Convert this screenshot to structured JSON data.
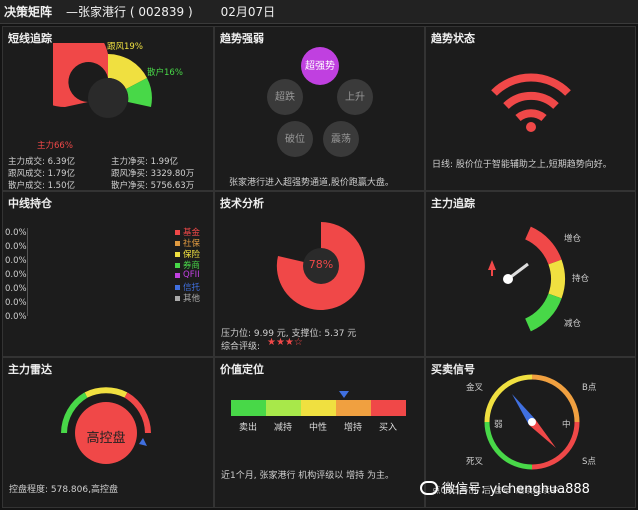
{
  "title": {
    "main": "决策矩阵",
    "stock": "—张家港行 ( 002839 )",
    "date": "02月07日"
  },
  "panels": {
    "short_track": {
      "title": "短线追踪",
      "labels": {
        "gengfeng": "跟风19%",
        "sanhu": "散户16%",
        "zhuli": "主力66%"
      },
      "stats": [
        "主力成交: 6.39亿",
        "主力净买: 1.99亿",
        "跟风成交: 1.79亿",
        "跟风净买: 3329.80万",
        "散户成交: 1.50亿",
        "散户净买: 5756.63万"
      ]
    },
    "trend_strength": {
      "title": "趋势强弱",
      "bubbles": [
        "超强势",
        "超跌",
        "上升",
        "破位",
        "震荡"
      ],
      "note": "张家港行进入超强势通道,股价跑赢大盘。"
    },
    "trend_state": {
      "title": "趋势状态",
      "note": "日线: 股价位于智能辅助之上,短期趋势向好。"
    },
    "mid_hold": {
      "title": "中线持仓",
      "axis": [
        "0.0%",
        "0.0%",
        "0.0%",
        "0.0%",
        "0.0%",
        "0.0%",
        "0.0%"
      ],
      "legend": [
        "基金",
        "社保",
        "保险",
        "券商",
        "QFII",
        "信托",
        "其他"
      ]
    },
    "tech": {
      "title": "技术分析",
      "percent": "78%",
      "pressure": "压力位: 9.99 元, 支撑位: 5.37 元",
      "rating_label": "综合评级:",
      "stars": "★★★☆"
    },
    "main_track": {
      "title": "主力追踪",
      "labels": [
        "增仓",
        "持仓",
        "减仓"
      ]
    },
    "radar": {
      "title": "主力雷达",
      "center": "高控盘",
      "note": "控盘程度: 578.806,高控盘"
    },
    "value": {
      "title": "价值定位",
      "labels": [
        "卖出",
        "减持",
        "中性",
        "增持",
        "买入"
      ],
      "note": "近1个月, 张家港行 机构评级以 增持 为主。"
    },
    "signal": {
      "title": "买卖信号",
      "labels": [
        "金叉",
        "B点",
        "弱",
        "中",
        "死叉",
        "S点"
      ],
      "partial": "点09日与出  后 信号  继续延续中..."
    }
  },
  "watermark": "微信号: yichenghua888",
  "colors": {
    "red": "#f04848",
    "yellow": "#f0e040",
    "green": "#48d848",
    "purple": "#c040e0"
  }
}
